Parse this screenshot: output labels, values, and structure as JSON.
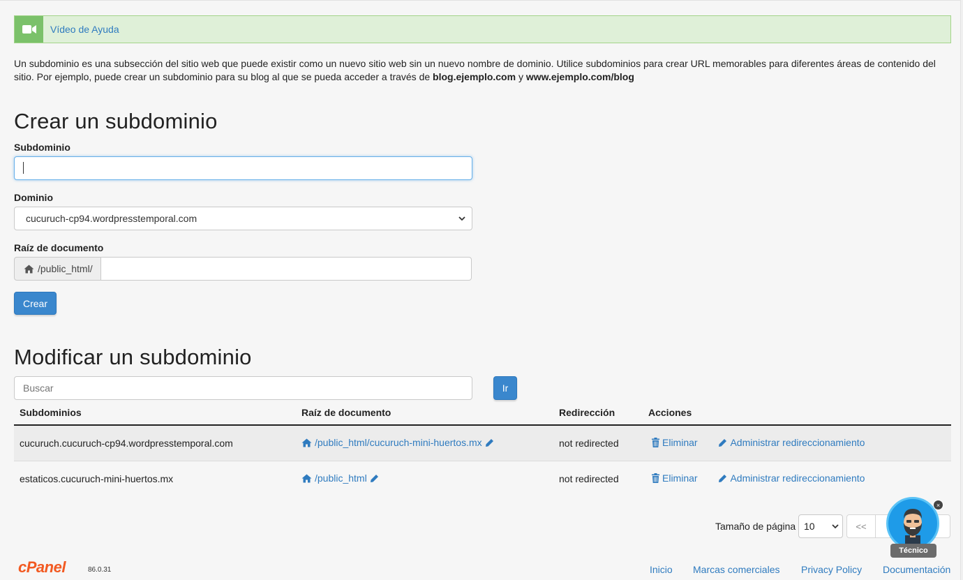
{
  "help": {
    "label": "Vídeo de Ayuda",
    "icon": "video-camera-icon"
  },
  "intro": {
    "text1": "Un subdominio es una subsección del sitio web que puede existir como un nuevo sitio web sin un nuevo nombre de dominio. Utilice subdominios para crear URL memorables para diferentes áreas de contenido del sitio. Por ejemplo, puede crear un subdominio para su blog al que se pueda acceder a través de ",
    "bold1": "blog.ejemplo.com",
    "text2": " y ",
    "bold2": "www.ejemplo.com/blog"
  },
  "create": {
    "title": "Crear un subdominio",
    "subdomain_label": "Subdominio",
    "subdomain_value": "",
    "domain_label": "Dominio",
    "domain_selected": "cucuruch-cp94.wordpresstemporal.com",
    "docroot_label": "Raíz de documento",
    "docroot_prefix": "/public_html/",
    "docroot_value": "",
    "submit_label": "Crear"
  },
  "modify": {
    "title": "Modificar un subdominio",
    "search_placeholder": "Buscar",
    "go_label": "Ir",
    "columns": [
      "Subdominios",
      "Raíz de documento",
      "Redirección",
      "Acciones"
    ],
    "rows": [
      {
        "subdomain": "cucuruch.cucuruch-cp94.wordpresstemporal.com",
        "docroot": "/public_html/cucuruch-mini-huertos.mx",
        "redirect": "not redirected",
        "delete": "Eliminar",
        "manage": "Administrar redireccionamiento"
      },
      {
        "subdomain": "estaticos.cucuruch-mini-huertos.mx",
        "docroot": "/public_html",
        "redirect": "not redirected",
        "delete": "Eliminar",
        "manage": "Administrar redireccionamiento"
      }
    ]
  },
  "pager": {
    "label": "Tamaño de página",
    "size": "10",
    "first": "<<"
  },
  "footer": {
    "logo": "cPanel",
    "version": "86.0.31",
    "links": [
      "Inicio",
      "Marcas comerciales",
      "Privacy Policy",
      "Documentación"
    ]
  },
  "assistant": {
    "label": "Técnico",
    "close": "×"
  },
  "colors": {
    "link": "#2f7bbf",
    "primary": "#3a87cd",
    "help_bg": "#dff0d8",
    "brand": "#f25a22"
  }
}
